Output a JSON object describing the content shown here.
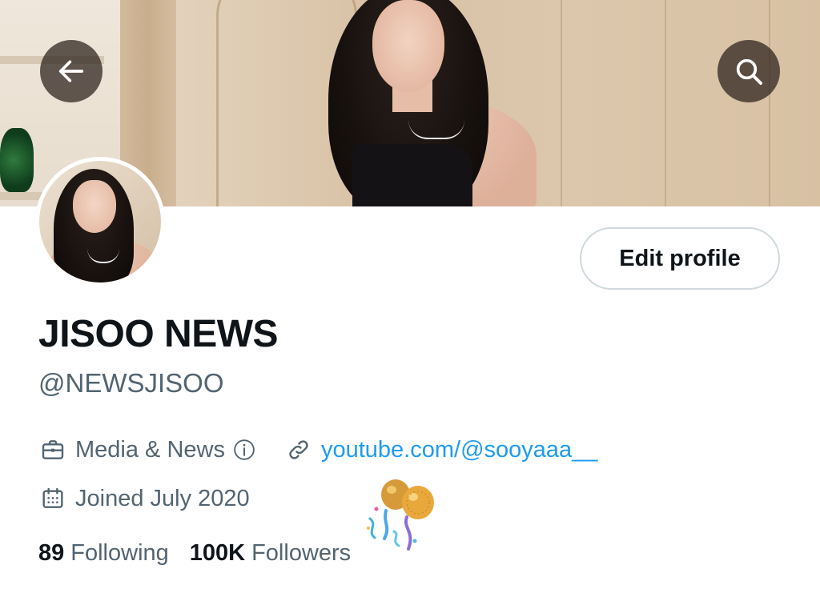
{
  "header": {
    "back_icon": "arrow-left-icon",
    "search_icon": "search-icon"
  },
  "profile": {
    "edit_button_label": "Edit profile",
    "display_name": "JISOO NEWS",
    "handle": "@NEWSJISOO",
    "category": "Media & News",
    "category_icon": "briefcase-icon",
    "info_icon": "info-icon",
    "link_icon": "link-icon",
    "link_text": "youtube.com/@sooyaaa__",
    "joined_icon": "calendar-icon",
    "joined_text": "Joined July 2020",
    "birthday_icon": "balloons-icon"
  },
  "stats": {
    "following_count": "89",
    "following_label": "Following",
    "followers_count": "100K",
    "followers_label": "Followers"
  },
  "colors": {
    "text_primary": "#0f1419",
    "text_secondary": "#536471",
    "link": "#1d9bf0",
    "button_border": "#cfd9de"
  }
}
